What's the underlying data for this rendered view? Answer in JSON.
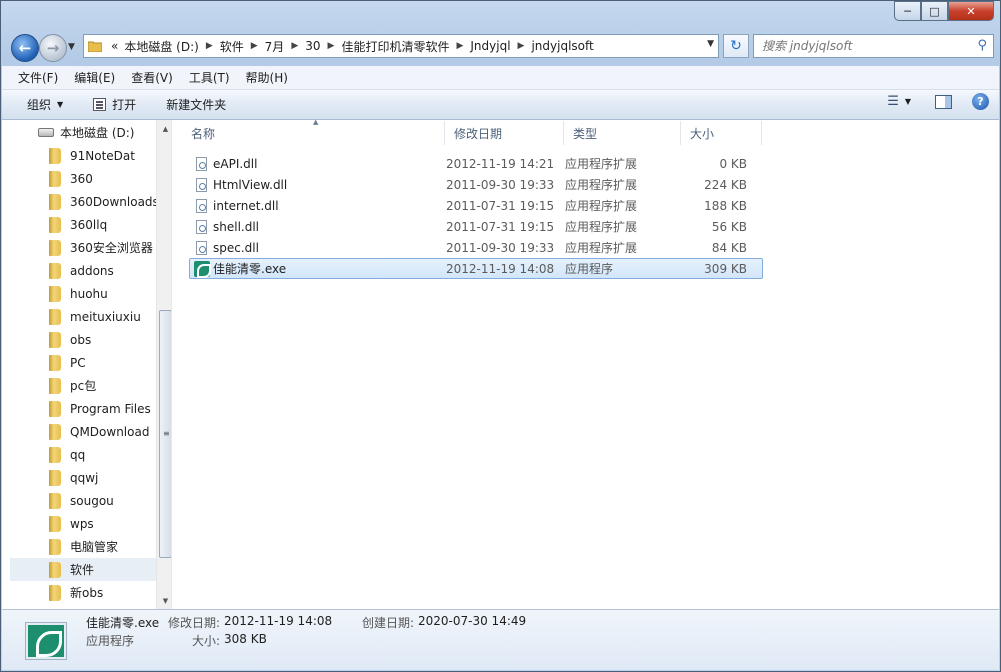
{
  "title_bar": {
    "controls": [
      "0",
      "1",
      "r"
    ]
  },
  "nav": {
    "back_label": "←",
    "forward_label": "→",
    "overflow": "«",
    "breadcrumbs": [
      "本地磁盘 (D:)",
      "软件",
      "7月",
      "30",
      "佳能打印机清零软件",
      "Jndyjql",
      "jndyjqlsoft"
    ],
    "search_placeholder": "搜索 jndyjqlsoft"
  },
  "menubar": [
    "文件(F)",
    "编辑(E)",
    "查看(V)",
    "工具(T)",
    "帮助(H)"
  ],
  "toolbar": {
    "organize": "组织",
    "open": "打开",
    "new_folder": "新建文件夹"
  },
  "nav_pane": {
    "drive": "本地磁盘 (D:)",
    "folders": [
      "91NoteDat",
      "360",
      "360Downloads",
      "360llq",
      "360安全浏览器",
      "addons",
      "huohu",
      "meituxiuxiu",
      "obs",
      "PC",
      "pc包",
      "Program Files",
      "QMDownload",
      "qq",
      "qqwj",
      "sougou",
      "wps",
      "电脑管家",
      "软件",
      "新obs"
    ],
    "selected": "软件"
  },
  "columns": [
    "名称",
    "修改日期",
    "类型",
    "大小"
  ],
  "files": [
    {
      "name": "eAPI.dll",
      "date": "2012-11-19 14:21",
      "type": "应用程序扩展",
      "size": "0 KB",
      "icon": "dll-file-icon"
    },
    {
      "name": "HtmlView.dll",
      "date": "2011-09-30 19:33",
      "type": "应用程序扩展",
      "size": "224 KB",
      "icon": "dll-file-icon"
    },
    {
      "name": "internet.dll",
      "date": "2011-07-31 19:15",
      "type": "应用程序扩展",
      "size": "188 KB",
      "icon": "dll-file-icon"
    },
    {
      "name": "shell.dll",
      "date": "2011-07-31 19:15",
      "type": "应用程序扩展",
      "size": "56 KB",
      "icon": "dll-file-icon"
    },
    {
      "name": "spec.dll",
      "date": "2011-09-30 19:33",
      "type": "应用程序扩展",
      "size": "84 KB",
      "icon": "dll-file-icon"
    },
    {
      "name": "佳能清零.exe",
      "date": "2012-11-19 14:08",
      "type": "应用程序",
      "size": "309 KB",
      "icon": "exe-app-icon",
      "selected": true
    }
  ],
  "details": {
    "name": "佳能清零.exe",
    "type": "应用程序",
    "modified_label": "修改日期:",
    "modified": "2012-11-19 14:08",
    "created_label": "创建日期:",
    "created": "2020-07-30 14:49",
    "size_label": "大小:",
    "size": "308 KB"
  },
  "colors": {
    "selection_bg": "#d2e6fa",
    "selection_border": "#84acdd",
    "app_icon": "#1e8f6e"
  }
}
